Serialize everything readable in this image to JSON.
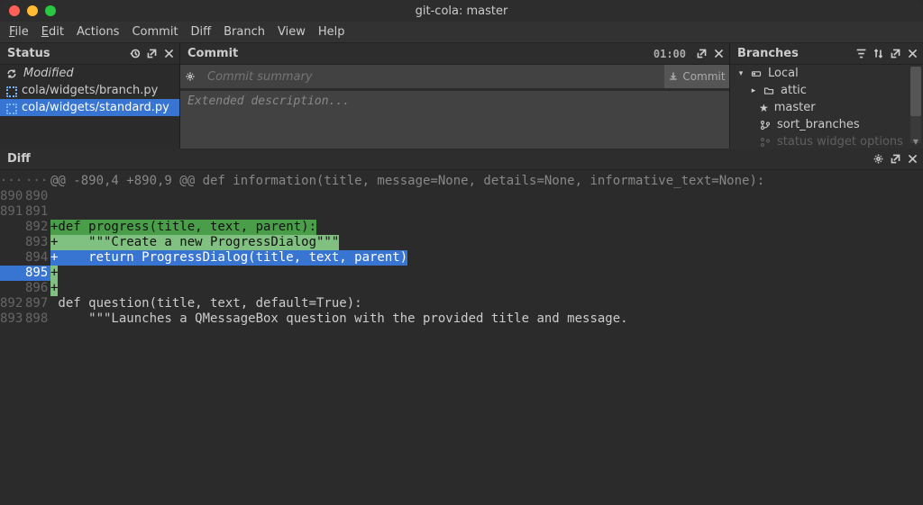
{
  "window": {
    "title": "git-cola: master"
  },
  "menubar": [
    "File",
    "Edit",
    "Actions",
    "Commit",
    "Diff",
    "Branch",
    "View",
    "Help"
  ],
  "status": {
    "title": "Status",
    "group": "Modified",
    "files": [
      "cola/widgets/branch.py",
      "cola/widgets/standard.py"
    ],
    "selected_index": 1
  },
  "commit": {
    "title": "Commit",
    "summary_placeholder": "Commit summary",
    "desc_placeholder": "Extended description...",
    "pos": "01:00",
    "button": "Commit"
  },
  "branches": {
    "title": "Branches",
    "root": "Local",
    "items": [
      "attic",
      "master",
      "sort_branches",
      "status widget options"
    ]
  },
  "diff": {
    "title": "Diff",
    "hunk": "@@ -890,4 +890,9 @@ def information(title, message=None, details=None, informative_text=None):",
    "lines": [
      {
        "o": "890",
        "n": "890",
        "t": ""
      },
      {
        "o": "891",
        "n": "891",
        "t": ""
      },
      {
        "o": "",
        "n": "892",
        "t": "def progress(title, text, parent):",
        "add": true,
        "hl": true
      },
      {
        "o": "",
        "n": "893",
        "t": "    \"\"\"Create a new ProgressDialog\"\"\"",
        "add": true
      },
      {
        "o": "",
        "n": "894",
        "t": "    return ProgressDialog(title, text, parent)",
        "add": true,
        "blue": true
      },
      {
        "o": "",
        "n": "895",
        "t": "",
        "add": true,
        "sel": true
      },
      {
        "o": "",
        "n": "896",
        "t": "",
        "add": true
      },
      {
        "o": "892",
        "n": "897",
        "t": " def question(title, text, default=True):"
      },
      {
        "o": "893",
        "n": "898",
        "t": "     \"\"\"Launches a QMessageBox question with the provided title and message."
      }
    ]
  }
}
